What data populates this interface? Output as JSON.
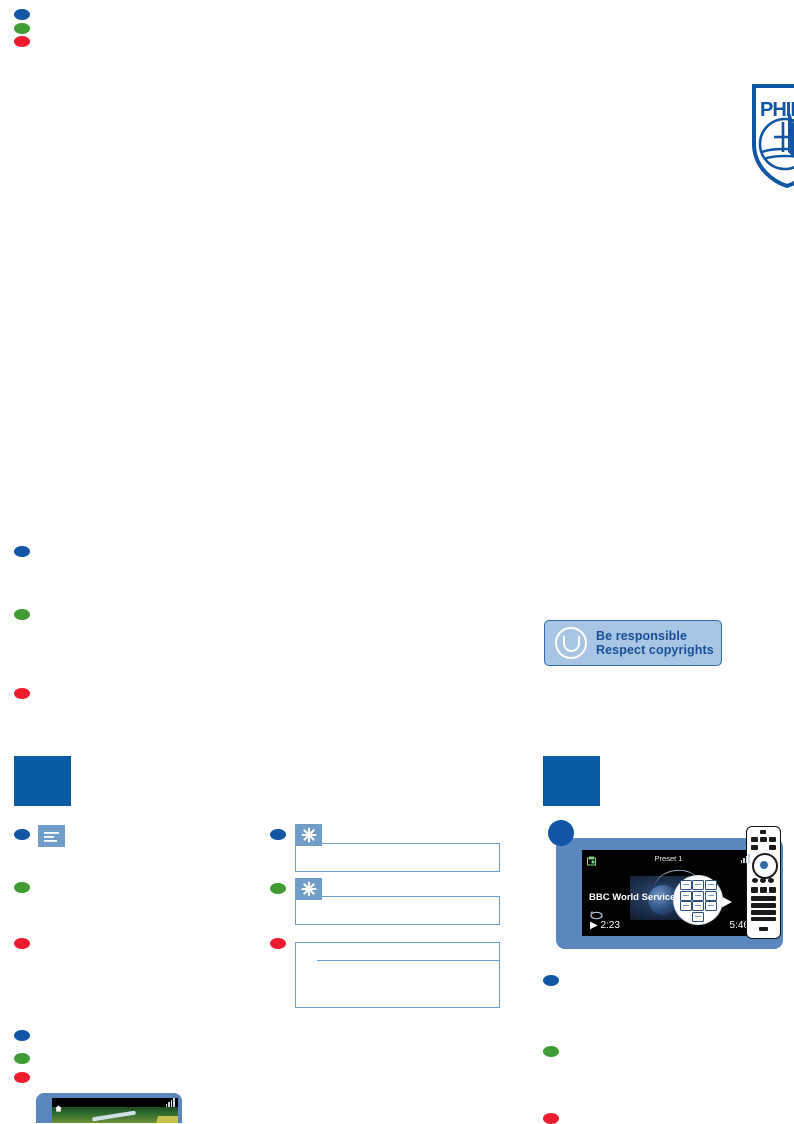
{
  "document": {
    "brand": "Philips",
    "page_background": "#ffffff",
    "accent_blue": "#0b5ba3",
    "note_border": "#6f9dc8"
  },
  "language_bullets": {
    "colors": {
      "blue": "#1056a4",
      "green": "#3f9c35",
      "red": "#ed1b2e"
    },
    "groups": [
      {
        "name": "header-language-bullets",
        "items": [
          "blue",
          "green",
          "red"
        ]
      },
      {
        "name": "mid-language-bullets",
        "items": [
          "blue",
          "green",
          "red"
        ]
      },
      {
        "name": "left-column-language-bullets",
        "items": [
          "blue",
          "green",
          "red"
        ]
      },
      {
        "name": "note-column-language-bullets",
        "items": [
          "blue",
          "green",
          "red"
        ]
      },
      {
        "name": "left-lower-language-bullets",
        "items": [
          "blue",
          "green",
          "red"
        ]
      },
      {
        "name": "right-column-language-bullets",
        "items": [
          "blue",
          "green",
          "red"
        ]
      }
    ]
  },
  "logo": {
    "name": "philips-shield-logo",
    "wordmark": "PHILIPS",
    "color": "#1056a4"
  },
  "copyright_badge": {
    "line1": "Be responsible",
    "line2": "Respect copyrights",
    "icon": "copyright-ring-icon",
    "background": "#a8c5e4",
    "text_color": "#1a4f96"
  },
  "chapters": [
    {
      "name": "chapter-marker-left",
      "color": "#0b5ba3"
    },
    {
      "name": "chapter-marker-right",
      "color": "#0b5ba3"
    }
  ],
  "note_badges": [
    {
      "name": "note-badge-lines",
      "icon": "text-lines-icon"
    },
    {
      "name": "tip-badge-asterisk-1",
      "icon": "asterisk-icon"
    },
    {
      "name": "tip-badge-asterisk-2",
      "icon": "asterisk-icon"
    }
  ],
  "note_boxes": [
    {
      "name": "note-box-1"
    },
    {
      "name": "note-box-2"
    },
    {
      "name": "note-box-3"
    }
  ],
  "device_illustration": {
    "name": "radio-player-screen",
    "card_color": "#5b87bf",
    "screen": {
      "status_title": "Preset 1",
      "status_left_icon": "radio-station-icon",
      "status_right_icon": "signal-bars-icon",
      "track_title": "BBC World Service New",
      "repeat_icon": "loop-icon",
      "play_icon": "play-icon",
      "elapsed_time": "2:23",
      "total_time": "5:46"
    },
    "magnifier": {
      "name": "keypad-magnifier",
      "depicts": "numeric-keypad"
    },
    "remote": {
      "name": "remote-control",
      "nav_pad": "circular-navigation-pad"
    },
    "step_marker": "step-1-circle"
  },
  "bottom_device": {
    "name": "portable-device-photo",
    "status_left_icon": "home-icon",
    "status_right_icon": "signal-bars-icon"
  }
}
